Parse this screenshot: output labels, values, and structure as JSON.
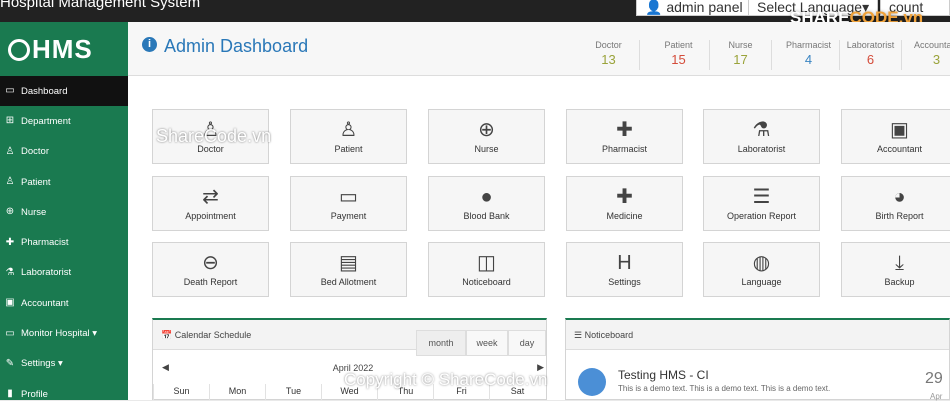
{
  "topbar": {
    "title": "Hospital Management System",
    "admin_panel": "admin panel",
    "language": "Select Language",
    "account": "count",
    "watermark": "SHARECODE.vn",
    "watermark_a": "SHARE",
    "watermark_b": "CODE.vn"
  },
  "logo": "HMS",
  "sidebar": {
    "items": [
      {
        "label": "Dashboard",
        "icon": "monitor-icon"
      },
      {
        "label": "Department",
        "icon": "sitemap-icon"
      },
      {
        "label": "Doctor",
        "icon": "user-md-icon"
      },
      {
        "label": "Patient",
        "icon": "user-icon"
      },
      {
        "label": "Nurse",
        "icon": "plus-square-icon"
      },
      {
        "label": "Pharmacist",
        "icon": "medkit-icon"
      },
      {
        "label": "Laboratorist",
        "icon": "flask-icon"
      },
      {
        "label": "Accountant",
        "icon": "money-icon"
      },
      {
        "label": "Monitor Hospital ▾",
        "icon": "desktop-icon"
      },
      {
        "label": "Settings ▾",
        "icon": "wrench-icon"
      },
      {
        "label": "Profile",
        "icon": "lock-icon"
      }
    ]
  },
  "header": {
    "title": "Admin Dashboard"
  },
  "stats": [
    {
      "label": "Doctor",
      "value": "13",
      "color": "#9aa33a"
    },
    {
      "label": "Patient",
      "value": "15",
      "color": "#d44c3a"
    },
    {
      "label": "Nurse",
      "value": "17",
      "color": "#9aa33a"
    },
    {
      "label": "Pharmacist",
      "value": "4",
      "color": "#3a85c2"
    },
    {
      "label": "Laboratorist",
      "value": "6",
      "color": "#d44c3a"
    },
    {
      "label": "Accountant",
      "value": "3",
      "color": "#9aa33a"
    }
  ],
  "tiles": [
    {
      "label": "Doctor",
      "icon": "user-md-icon"
    },
    {
      "label": "Patient",
      "icon": "user-icon"
    },
    {
      "label": "Nurse",
      "icon": "plus-square-icon"
    },
    {
      "label": "Pharmacist",
      "icon": "medkit-icon"
    },
    {
      "label": "Laboratorist",
      "icon": "flask-icon"
    },
    {
      "label": "Accountant",
      "icon": "money-icon"
    },
    {
      "label": "Appointment",
      "icon": "exchange-icon"
    },
    {
      "label": "Payment",
      "icon": "credit-card-icon"
    },
    {
      "label": "Blood Bank",
      "icon": "drop-icon"
    },
    {
      "label": "Medicine",
      "icon": "medkit-icon"
    },
    {
      "label": "Operation Report",
      "icon": "bars-icon"
    },
    {
      "label": "Birth Report",
      "icon": "github-icon"
    },
    {
      "label": "Death Report",
      "icon": "minus-circle-icon"
    },
    {
      "label": "Bed Allotment",
      "icon": "hdd-icon"
    },
    {
      "label": "Noticeboard",
      "icon": "columns-icon"
    },
    {
      "label": "Settings",
      "icon": "h-square-icon"
    },
    {
      "label": "Language",
      "icon": "globe-icon"
    },
    {
      "label": "Backup",
      "icon": "download-icon"
    }
  ],
  "calendar": {
    "title": "Calendar Schedule",
    "month": "April 2022",
    "views": [
      "month",
      "week",
      "day"
    ],
    "days": [
      "Sun",
      "Mon",
      "Tue",
      "Wed",
      "Thu",
      "Fri",
      "Sat"
    ]
  },
  "noticeboard": {
    "title": "Noticeboard",
    "item_title": "Testing HMS - CI",
    "item_text": "This is a demo text. This is a demo text. This is a demo text.",
    "date": "29",
    "month": "Apr"
  },
  "overlay": {
    "tile_watermark": "ShareCode.vn",
    "copyright": "Copyright © ShareCode.vn"
  },
  "colors": {
    "sidebar": "#1a7a50",
    "accent": "#2a78b8"
  }
}
